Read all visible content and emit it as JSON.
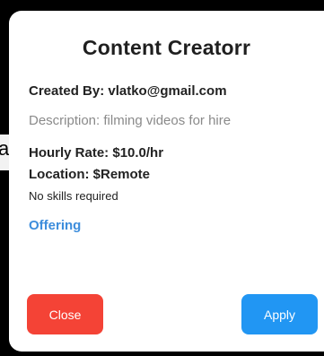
{
  "background_partial_text": "a",
  "dialog": {
    "title": "Content Creatorr",
    "created_by": "Created By: vlatko@gmail.com",
    "description": "Description: filming videos for hire",
    "hourly_rate": "Hourly Rate: $10.0/hr",
    "location": "Location: $Remote",
    "skills": "No skills required",
    "offering": "Offering",
    "close_label": "Close",
    "apply_label": "Apply"
  },
  "colors": {
    "close": "#f44336",
    "apply": "#2196f3",
    "offering": "#3d8ddc",
    "description": "#8a8a8a"
  }
}
